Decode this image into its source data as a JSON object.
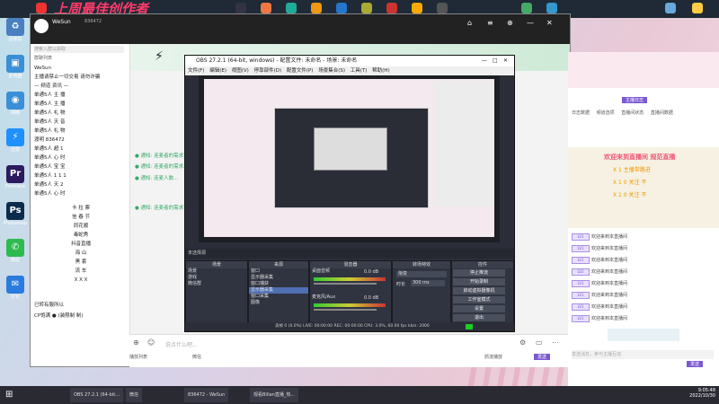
{
  "banner": {
    "text": "上周最佳创作者"
  },
  "desktop_icons": [
    {
      "label": "回收站",
      "color": "#4a7fc1"
    },
    {
      "label": "此电脑",
      "color": "#3b8fd6"
    },
    {
      "label": "网络",
      "color": "#3b8fd6"
    },
    {
      "label": "迅雷",
      "color": "#1e90ff"
    },
    {
      "label": "Premiere",
      "color": "#2b1a5e"
    },
    {
      "label": "Photoshop",
      "color": "#0a2b4c"
    },
    {
      "label": "微信",
      "color": "#2dba4e"
    },
    {
      "label": "钉钉",
      "color": "#2a7bde"
    }
  ],
  "chat": {
    "title": "WeSun",
    "user_id": "836472",
    "search_placeholder": "搜索入群以获取",
    "section_label": "群聊列表",
    "groups": [
      "WeSun",
      "主播请禁止一切交易 请勿诈骗",
      "— 频道 资讯 —",
      "单通5人 主 播",
      "单通5人 主 播",
      "单通5人 礼 物",
      "单通5人 天 音",
      "单通5人 礼 物",
      "渡明 836472",
      "单通5人 超 1",
      "单通5人 心 时",
      "单通5人 宝 宝",
      "单通5人 1 1 1",
      "单通5人 天 2",
      "单通5人 心 时"
    ],
    "groups2": [
      "卡 拉 票",
      "信 春 节",
      "同花顺",
      "毒蛇秀",
      "抖音直播",
      "海 山",
      "黑 套",
      "流 车",
      "X X X"
    ],
    "footer_items": [
      "已转有服所以",
      "CP饱满 ● (装限制 制)"
    ],
    "messages": [
      "● 通知: 连麦者的需求已...",
      "● 通知: 连麦者的需求...",
      "● 通知: 连麦人数...",
      "● 通知: 连麦者的需求已改..."
    ],
    "input_placeholder": "说点什么吧...",
    "bottom_left": "播放列表",
    "bottom_mid": "微信",
    "bottom_right_buttons": [
      "抓流播放",
      "发送"
    ]
  },
  "obs": {
    "title": "OBS 27.2.1 (64-bit, windows) - 配置文件: 未命名 - 场景: 未命名",
    "menu": [
      "文件(F)",
      "编辑(E)",
      "视图(V)",
      "停靠部件(D)",
      "配置文件(P)",
      "场景集合(S)",
      "工具(T)",
      "帮助(H)"
    ],
    "source_bar": "未选择源",
    "scenes_header": "场景",
    "scenes": [
      "场景",
      "游戏",
      "微信群"
    ],
    "sources_header": "来源",
    "sources": [
      "窗口",
      "显示器采集",
      "窗口捕获",
      "显示器采集",
      "窗口采集",
      "图像"
    ],
    "mixer_header": "混音器",
    "mixer": [
      {
        "name": "桌面音频",
        "db": "0.0 dB"
      },
      {
        "name": "麦克风/Aux",
        "db": "0.0 dB"
      }
    ],
    "transitions_header": "转场特效",
    "transition_type": "渐变",
    "duration_label": "时长",
    "duration": "300 ms",
    "controls_header": "控件",
    "controls": [
      "停止推流",
      "开始录制",
      "启动虚拟摄像机",
      "工作室模式",
      "设置",
      "退出"
    ],
    "status": "丢帧 0 (0.0%)   LIVE: 00:00:00   REC: 00:00:00   CPU: 3.0%, 60.00 fps   kb/s: 2000"
  },
  "right_panel": {
    "tabs": [
      "日志数据",
      "频道选项",
      "直播间状态",
      "直播间数据"
    ],
    "live_label": "主播日志",
    "notice_lines": [
      "欢迎来到直播间 规范直播",
      "X 1 主播带路进",
      "X 1 0 关注 不",
      "X 1 0 关注 不"
    ],
    "rows": [
      {
        "lv": "LV1",
        "text": "欢迎来到本直播间"
      },
      {
        "lv": "LV1",
        "text": "欢迎来到本直播间"
      },
      {
        "lv": "LV1",
        "text": "欢迎来到本直播间"
      },
      {
        "lv": "LV2",
        "text": "欢迎来到本直播间"
      },
      {
        "lv": "LV1",
        "text": "欢迎来到本直播间"
      },
      {
        "lv": "LV1",
        "text": "欢迎来到本直播间"
      },
      {
        "lv": "LV1",
        "text": "欢迎来到本直播间"
      },
      {
        "lv": "LV1",
        "text": "欢迎来到本直播间"
      }
    ],
    "input_placeholder": "发送消息，参与主播互动",
    "send_button": "发送"
  },
  "taskbar": {
    "items": [
      "OBS 27.2.1 (64-bit...",
      "微信",
      "836472 - WeSun",
      "观看Billan直播_热..."
    ],
    "time": "9:05:48",
    "date": "2022/10/30"
  }
}
